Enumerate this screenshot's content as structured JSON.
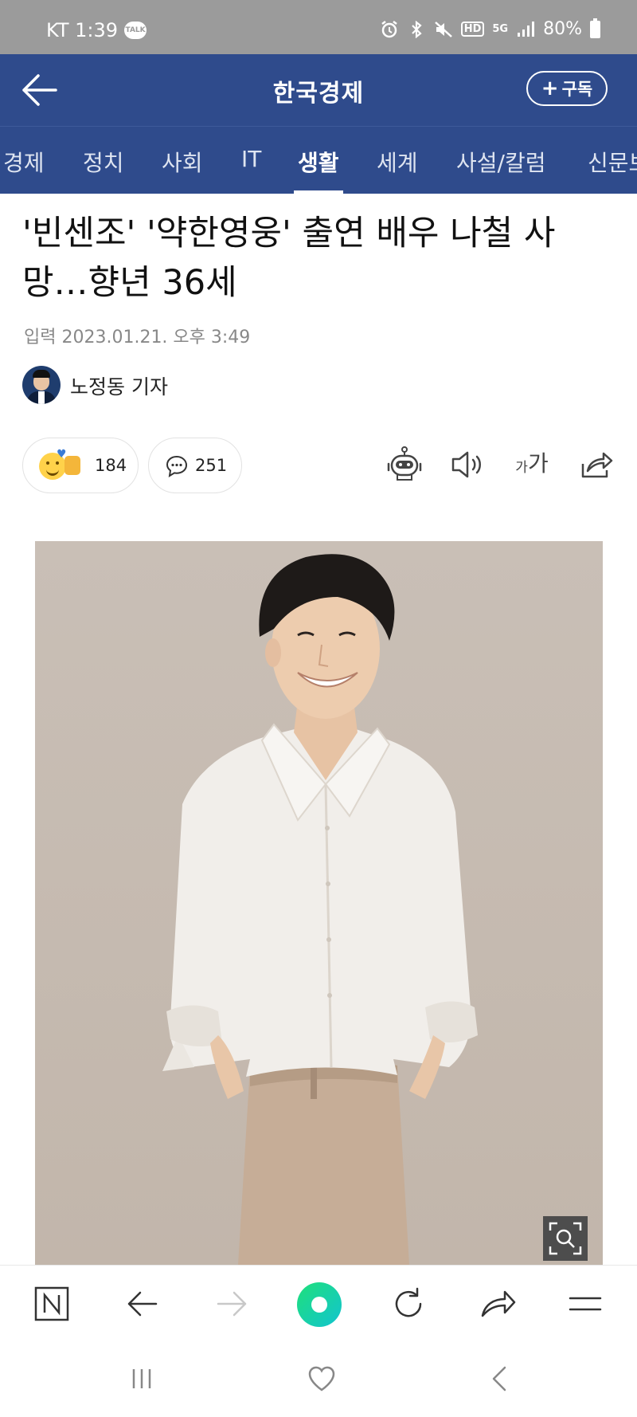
{
  "status_bar": {
    "carrier_time": "KT 1:39",
    "talk_badge": "TALK",
    "hd_label": "HD",
    "network_label": "5G",
    "battery": "80%"
  },
  "header": {
    "title": "한국경제",
    "subscribe_label": "구독"
  },
  "tabs": [
    {
      "label": "경제"
    },
    {
      "label": "정치"
    },
    {
      "label": "사회"
    },
    {
      "label": "IT"
    },
    {
      "label": "생활",
      "active": true
    },
    {
      "label": "세계"
    },
    {
      "label": "사설/칼럼"
    },
    {
      "label": "신문보"
    }
  ],
  "article": {
    "headline": "'빈센조' '약한영웅' 출연 배우 나철 사망…향년 36세",
    "date": "입력 2023.01.21. 오후 3:49",
    "author": "노정동 기자",
    "reaction_count": "184",
    "comment_count": "251",
    "font_size_label_small": "가",
    "font_size_label_large": "가"
  },
  "icons": {
    "back": "back-arrow-icon",
    "robot": "robot-icon",
    "speaker": "speaker-icon",
    "share": "share-icon",
    "zoom": "zoom-search-icon"
  },
  "colors": {
    "header_bg": "#2f4b8c",
    "status_bg": "#9b9b9b",
    "accent_green": "#19d2a0"
  }
}
